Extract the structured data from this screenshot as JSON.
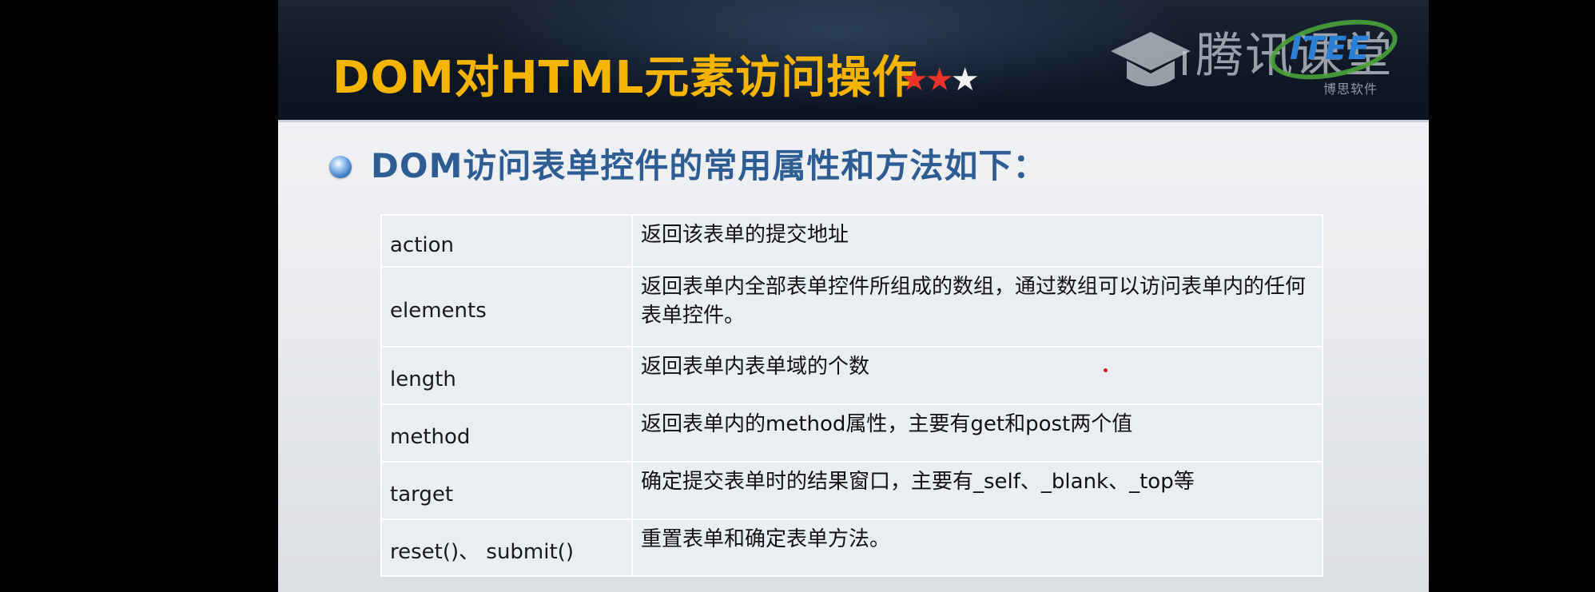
{
  "slide": {
    "title": "DOM对HTML元素访问操作",
    "difficulty_stars_filled": 2,
    "difficulty_stars_total": 3,
    "logo": {
      "text": "腾讯课堂",
      "brand": "ITEE",
      "sub": "博思软件"
    },
    "subtitle": "DOM访问表单控件的常用属性和方法如下：",
    "table": {
      "rows": [
        {
          "name": "action",
          "desc": "返回该表单的提交地址"
        },
        {
          "name": "elements",
          "desc": "返回表单内全部表单控件所组成的数组，通过数组可以访问表单内的任何表单控件。"
        },
        {
          "name": "length",
          "desc": "返回表单内表单域的个数"
        },
        {
          "name": "method",
          "desc": "返回表单内的method属性，主要有get和post两个值"
        },
        {
          "name": "target",
          "desc": "确定提交表单时的结果窗口，主要有_self、_blank、_top等"
        },
        {
          "name": "reset()、 submit()",
          "desc": "重置表单和确定表单方法。"
        }
      ]
    }
  },
  "colors": {
    "title": "#f4b400",
    "subtitle": "#2d5d93",
    "star_filled": "#e8332a",
    "star_empty": "#f0f0f0",
    "header_bg": "#101826"
  },
  "icons": [
    "bullet-circle-icon",
    "graduation-cap-icon",
    "star-icon"
  ]
}
